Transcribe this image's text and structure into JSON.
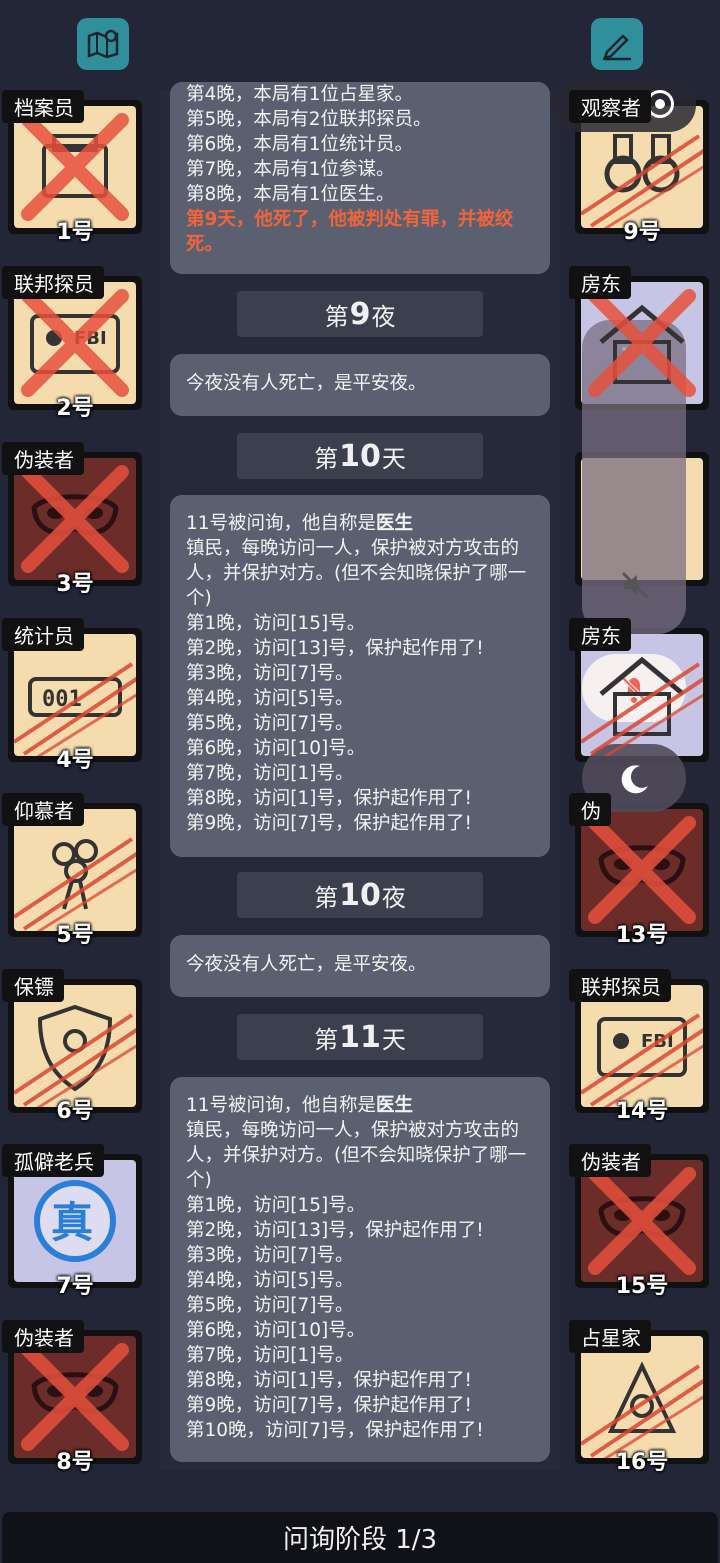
{
  "top_icons": {
    "left": "map-icon",
    "right": "edit-icon"
  },
  "log": {
    "partial_message": {
      "lines": [
        "第4晚，本局有1位占星家。",
        "第5晚，本局有2位联邦探员。",
        "第6晚，本局有1位统计员。",
        "第7晚，本局有1位参谋。",
        "第8晚，本局有1位医生。"
      ],
      "highlight": "第9天，他死了，他被判处有罪，并被绞死。"
    },
    "night9": {
      "prefix": "第",
      "num": "9",
      "suffix": "夜"
    },
    "night9_msg": "今夜没有人死亡，是平安夜。",
    "day10": {
      "prefix": "第",
      "num": "10",
      "suffix": "天"
    },
    "day10_msg": {
      "intro": "11号被问询，他自称是",
      "role": "医生",
      "desc": "镇民，每晚访问一人，保护被对方攻击的人，并保护对方。(但不会知晓保护了哪一个)",
      "lines": [
        "第1晚，访问[15]号。",
        "第2晚，访问[13]号，保护起作用了!",
        "第3晚，访问[7]号。",
        "第4晚，访问[5]号。",
        "第5晚，访问[7]号。",
        "第6晚，访问[10]号。",
        "第7晚，访问[1]号。",
        "第8晚，访问[1]号，保护起作用了!",
        "第9晚，访问[7]号，保护起作用了!"
      ]
    },
    "night10": {
      "prefix": "第",
      "num": "10",
      "suffix": "夜"
    },
    "night10_msg": "今夜没有人死亡，是平安夜。",
    "day11": {
      "prefix": "第",
      "num": "11",
      "suffix": "天"
    },
    "day11_msg": {
      "intro": "11号被问询，他自称是",
      "role": "医生",
      "desc": "镇民，每晚访问一人，保护被对方攻击的人，并保护对方。(但不会知晓保护了哪一个)",
      "lines": [
        "第1晚，访问[15]号。",
        "第2晚，访问[13]号，保护起作用了!",
        "第3晚，访问[7]号。",
        "第4晚，访问[5]号。",
        "第5晚，访问[7]号。",
        "第6晚，访问[10]号。",
        "第7晚，访问[1]号。",
        "第8晚，访问[1]号，保护起作用了!",
        "第9晚，访问[7]号，保护起作用了!",
        "第10晚，访问[7]号，保护起作用了!"
      ]
    }
  },
  "players_left": [
    {
      "role": "档案员",
      "num": "1号",
      "bg": "cream",
      "dead": true,
      "icon": "folder-icon"
    },
    {
      "role": "联邦探员",
      "num": "2号",
      "bg": "cream",
      "dead": true,
      "icon": "fbi-badge-icon"
    },
    {
      "role": "伪装者",
      "num": "3号",
      "bg": "dark",
      "dead": true,
      "icon": "mask-icon"
    },
    {
      "role": "统计员",
      "num": "4号",
      "bg": "cream",
      "dead": false,
      "icon": "counter-icon"
    },
    {
      "role": "仰慕者",
      "num": "5号",
      "bg": "cream",
      "dead": false,
      "icon": "bouquet-icon"
    },
    {
      "role": "保镖",
      "num": "6号",
      "bg": "cream",
      "dead": false,
      "icon": "shield-icon"
    },
    {
      "role": "孤僻老兵",
      "num": "7号",
      "bg": "lav",
      "dead": false,
      "icon": "verified-stamp-icon",
      "stamp": "真"
    },
    {
      "role": "伪装者",
      "num": "8号",
      "bg": "dark",
      "dead": true,
      "icon": "mask-icon"
    }
  ],
  "players_right": [
    {
      "role": "观察者",
      "num": "9号",
      "bg": "cream",
      "dead": false,
      "icon": "binoculars-icon"
    },
    {
      "role": "房东",
      "num": "",
      "bg": "lav",
      "dead": true,
      "icon": "house-icon"
    },
    {
      "role": "",
      "num": "",
      "bg": "cream",
      "dead": false,
      "icon": "blank-icon"
    },
    {
      "role": "房东",
      "num": "",
      "bg": "lav",
      "dead": false,
      "icon": "house-icon"
    },
    {
      "role": "伪",
      "num": "13号",
      "bg": "dark",
      "dead": true,
      "icon": "mask-icon"
    },
    {
      "role": "联邦探员",
      "num": "14号",
      "bg": "cream",
      "dead": false,
      "icon": "fbi-badge-icon"
    },
    {
      "role": "伪装者",
      "num": "15号",
      "bg": "dark",
      "dead": true,
      "icon": "mask-icon"
    },
    {
      "role": "占星家",
      "num": "16号",
      "bg": "cream",
      "dead": false,
      "icon": "sextant-icon"
    }
  ],
  "bottom_bar": {
    "label": "问询阶段 1/3"
  },
  "colors": {
    "background": "#222637",
    "bubble": "#5b6070",
    "highlight": "#f0643c",
    "teal": "#2f8f9b"
  }
}
